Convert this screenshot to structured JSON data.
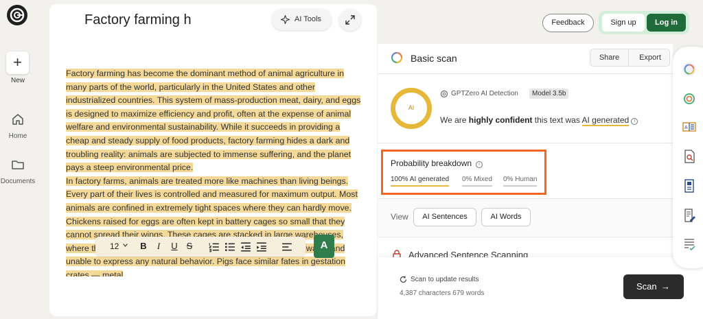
{
  "rail": {
    "new_label": "New",
    "home_label": "Home",
    "documents_label": "Documents"
  },
  "editor": {
    "title": "Factory farming h",
    "ai_tools_label": "AI Tools",
    "font_size": "12",
    "grammar_label": "A",
    "paragraphs": [
      [
        "Factory farming has become the dominant method of animal agriculture in many parts of the world, particularly in the United States and other industrialized countries.",
        " This system of mass-production meat, dairy, and eggs is designed to maximize efficiency and profit, often at the expense of animal welfare and environmental sustainability.",
        " While it succeeds in providing a cheap and steady supply of food products, factory farming hides a dark and troubling reality: animals are subjected to immense suffering, and the planet pays a steep environmental price."
      ],
      [
        "In factory farms, animals are treated more like machines than living beings.",
        " Every part of their lives is controlled and measured for maximum output.",
        " Most animals are confined in extremely tight spaces where they can hardly move.",
        " Chickens raised for eggs are often kept in battery cages so small that they cannot spread their wings.",
        " These cages are stacked in large warehouses, where the birds live in constant stress, surrounded by their own waste and unable to express any natural behavior.",
        " Pigs face similar fates in gestation crates — metal"
      ]
    ]
  },
  "header": {
    "feedback_label": "Feedback",
    "signup_label": "Sign up",
    "login_label": "Log in"
  },
  "scan": {
    "title": "Basic scan",
    "share_label": "Share",
    "export_label": "Export",
    "ring_label": "AI",
    "detector_label": "GPTZero AI Detection",
    "model_label": "Model 3.5b",
    "verdict_prefix": "We are ",
    "verdict_confidence": "highly confident",
    "verdict_middle": " this text was ",
    "verdict_result": "AI generated",
    "probability_title": "Probability breakdown",
    "prob_ai": "100% AI generated",
    "prob_mixed": "0% Mixed",
    "prob_human": "0% Human",
    "view_label": "View",
    "view_sentences": "AI Sentences",
    "view_words": "AI Words",
    "advanced_title": "Advanced Sentence Scanning",
    "update_label": "Scan to update results",
    "counts_label": "4,387 characters 679 words",
    "scan_button": "Scan",
    "scan_arrow": "→"
  },
  "colors": {
    "highlight": "#f4d999",
    "ai_yellow": "#e5b83a",
    "brand_green": "#1f6b3a",
    "callout_orange": "#f26522"
  }
}
